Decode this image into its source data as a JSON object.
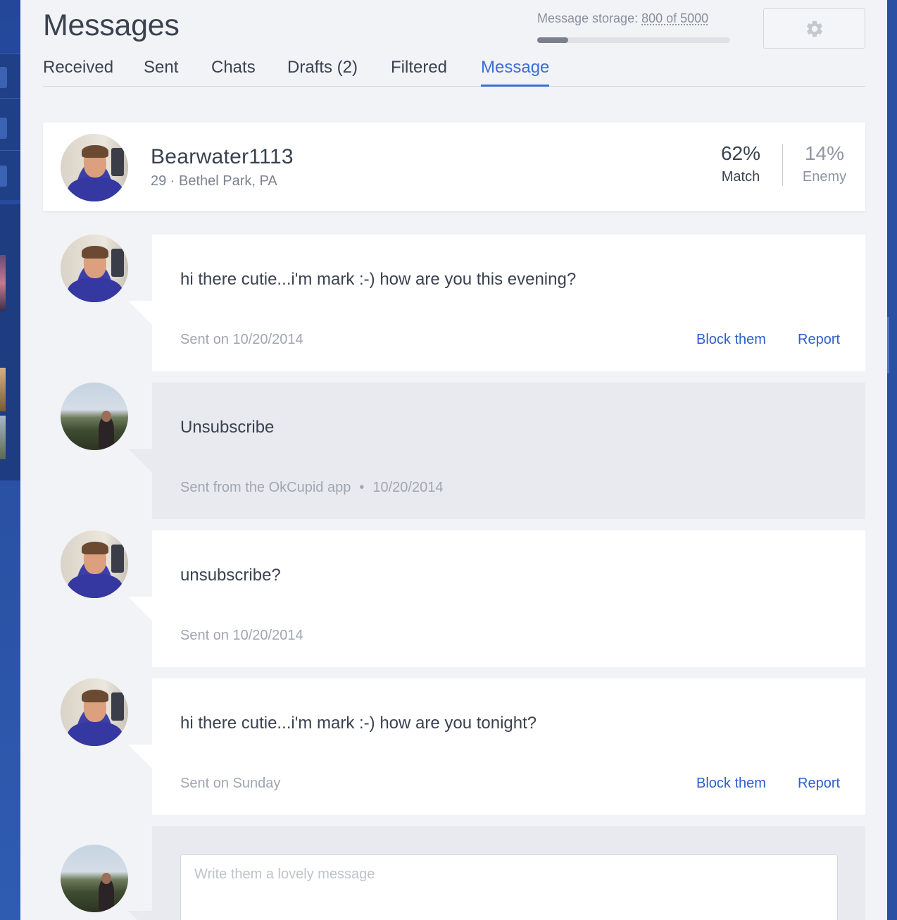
{
  "header": {
    "title": "Messages",
    "storage_label": "Message storage:",
    "storage_count": "800 of 5000",
    "storage_used_fraction": 0.16,
    "settings_icon": "gear-icon"
  },
  "tabs": [
    {
      "label": "Received"
    },
    {
      "label": "Sent"
    },
    {
      "label": "Chats"
    },
    {
      "label": "Drafts (2)"
    },
    {
      "label": "Filtered"
    },
    {
      "label": "Message",
      "active": true
    }
  ],
  "profile": {
    "username": "Bearwater1113",
    "age": "29",
    "location": "Bethel Park, PA",
    "subinfo": "29 · Bethel Park, PA",
    "match_pct": "62%",
    "match_label": "Match",
    "enemy_pct": "14%",
    "enemy_label": "Enemy"
  },
  "messages": [
    {
      "from": "them",
      "text": "hi there cutie...i'm mark :-) how are you this evening?",
      "meta": "Sent on 10/20/2014",
      "block_label": "Block them",
      "report_label": "Report"
    },
    {
      "from": "me",
      "text": "Unsubscribe",
      "meta": "Sent from the OkCupid app",
      "meta_date": "10/20/2014",
      "meta_sep": "•"
    },
    {
      "from": "them",
      "text": "unsubscribe?",
      "meta": "Sent on 10/20/2014"
    },
    {
      "from": "them",
      "text": "hi there cutie...i'm mark :-) how are you tonight?",
      "meta": "Sent on Sunday",
      "block_label": "Block them",
      "report_label": "Report"
    }
  ],
  "compose": {
    "placeholder": "Write them a lovely message",
    "value": ""
  },
  "colors": {
    "accent": "#3a6ed4",
    "link": "#2f5fc8",
    "background": "#2c54a6",
    "panel": "#f2f3f7"
  }
}
